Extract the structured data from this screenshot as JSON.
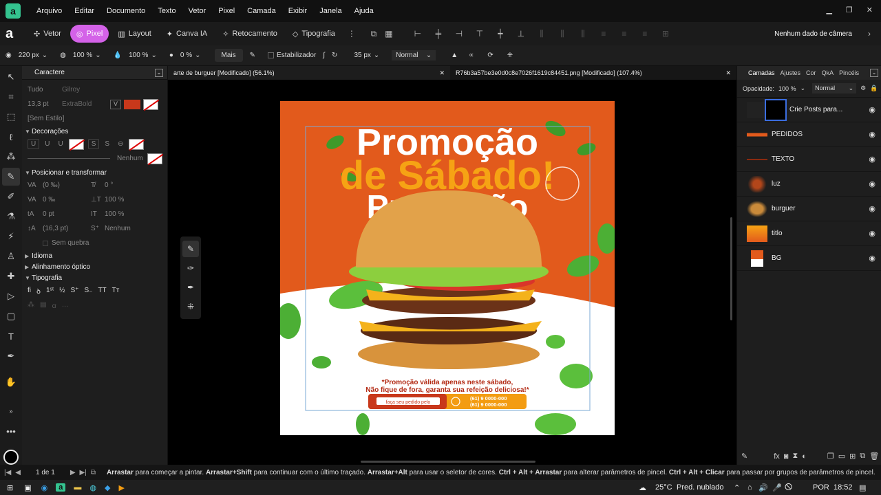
{
  "app": {
    "menu": [
      "Arquivo",
      "Editar",
      "Documento",
      "Texto",
      "Vetor",
      "Pixel",
      "Camada",
      "Exibir",
      "Janela",
      "Ajuda"
    ]
  },
  "toolbar": {
    "personas": [
      {
        "label": "Vetor",
        "active": false
      },
      {
        "label": "Pixel",
        "active": true
      },
      {
        "label": "Layout",
        "active": false
      },
      {
        "label": "Canva IA",
        "active": false
      },
      {
        "label": "Retocamento",
        "active": false
      },
      {
        "label": "Tipografia",
        "active": false
      }
    ],
    "camera_status": "Nenhum dado de câmera"
  },
  "context": {
    "size": "220 px",
    "opacity": "100 %",
    "flow": "100 %",
    "hardness": "0 %",
    "more_label": "Mais",
    "stabilizer_label": "Estabilizador",
    "stabilizer_value": "35 px",
    "blend_mode": "Normal"
  },
  "character_panel": {
    "tab_label": "Caractere",
    "font_collection": "Tudo",
    "font_family": "Gilroy",
    "font_size": "13,3 pt",
    "font_weight": "ExtraBold",
    "text_color": "#c8381b",
    "style": "[Sem Estilo]",
    "decoracoes_label": "Decorações",
    "none_label": "Nenhum",
    "transform_label": "Posicionar e transformar",
    "transform_values": [
      "(0 ‰)",
      "0 °",
      "0 ‰",
      "100 %",
      "0 pt",
      "100 %",
      "(16,3 pt)",
      "Nenhum"
    ],
    "no_break_label": "Sem quebra",
    "idioma_label": "Idioma",
    "alinhamento_label": "Alinhamento óptico",
    "tipografia_label": "Tipografia"
  },
  "doctabs": [
    {
      "title": "arte de burguer [Modificado] (56.1%)",
      "active": true
    },
    {
      "title": "R76b3a57be3e0d0c8e7026f1619c84451.png [Modificado] (107.4%)",
      "active": false
    }
  ],
  "artwork": {
    "title_line1": "Promoção",
    "title_line2": "de Sábado!",
    "echo_line1": "Promoção",
    "disclaimer_line1": "*Promoção válida apenas neste sábado,",
    "disclaimer_line2": "Não fique de fora, garanta sua refeição deliciosa!*",
    "order_label": "faça seu pedido pelo",
    "phone1": "(61) 9 0000-000",
    "phone2": "(61) 9 0000-000",
    "colors": {
      "bg": "#e25a1c",
      "yellow": "#f6a314",
      "white": "#ffffff",
      "red": "#b32a14"
    }
  },
  "right_panel": {
    "tabs": [
      "Camadas",
      "Ajustes",
      "Cor",
      "QkA",
      "Pincéis"
    ],
    "opacity_label": "Opacidade:",
    "opacity_value": "100 %",
    "blend": "Normal",
    "layers": [
      {
        "name": "Crie Posts para..."
      },
      {
        "name": "PEDIDOS"
      },
      {
        "name": "TEXTO"
      },
      {
        "name": "luz"
      },
      {
        "name": "burguer"
      },
      {
        "name": "titlo"
      },
      {
        "name": "BG"
      }
    ]
  },
  "statusbar": {
    "page": "1 de 1",
    "hint_parts": [
      {
        "b": "Arrastar",
        "t": " para começar a pintar. "
      },
      {
        "b": "Arrastar+Shift",
        "t": " para continuar com o último traçado. "
      },
      {
        "b": "Arrastar+Alt",
        "t": " para usar o seletor de cores. "
      },
      {
        "b": "Ctrl + Alt + Arrastar",
        "t": " para alterar parâmetros de pincel. "
      },
      {
        "b": "Ctrl + Alt + Clicar",
        "t": " para passar por grupos de parâmetros de pincel."
      }
    ]
  },
  "taskbar": {
    "weather": "25°C",
    "weather_text": "Pred. nublado",
    "lang": "POR",
    "time": "18:52"
  }
}
